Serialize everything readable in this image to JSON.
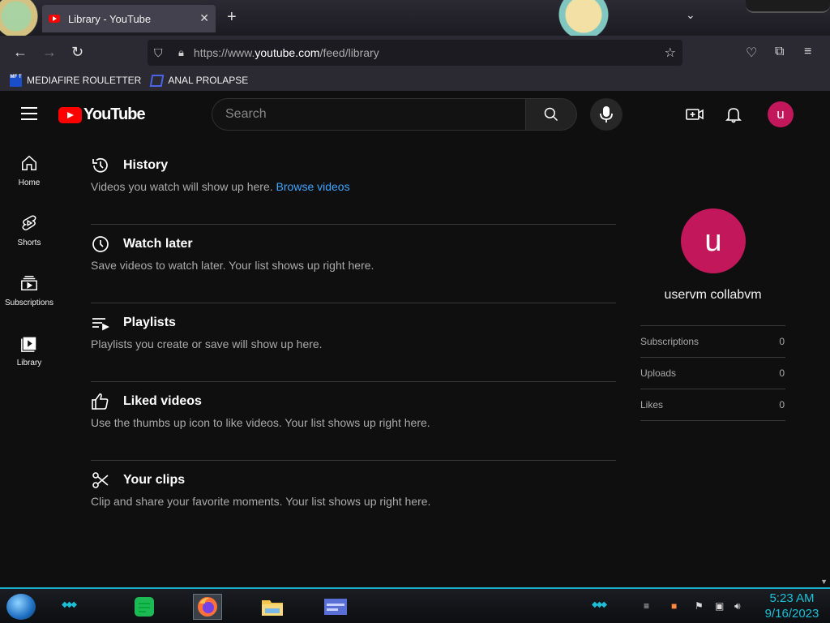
{
  "browser": {
    "tab_title": "Library - YouTube",
    "url_prefix": "https://www.",
    "url_domain": "youtube.com",
    "url_path": "/feed/library",
    "bookmarks": [
      {
        "label": "MEDIAFIRE ROULETTER",
        "icon_text": "MF T"
      },
      {
        "label": "ANAL PROLAPSE"
      }
    ]
  },
  "masthead": {
    "logo_text": "YouTube",
    "search_placeholder": "Search",
    "avatar_letter": "u"
  },
  "guide": [
    {
      "label": "Home",
      "icon": "home-icon"
    },
    {
      "label": "Shorts",
      "icon": "shorts-icon"
    },
    {
      "label": "Subscriptions",
      "icon": "subscriptions-icon"
    },
    {
      "label": "Library",
      "icon": "library-icon"
    }
  ],
  "sections": [
    {
      "title": "History",
      "desc": "Videos you watch will show up here. ",
      "link": "Browse videos",
      "icon": "history-icon"
    },
    {
      "title": "Watch later",
      "desc": "Save videos to watch later. Your list shows up right here.",
      "icon": "clock-icon"
    },
    {
      "title": "Playlists",
      "desc": "Playlists you create or save will show up here.",
      "icon": "playlist-icon"
    },
    {
      "title": "Liked videos",
      "desc": "Use the thumbs up icon to like videos. Your list shows up right here.",
      "icon": "thumbs-up-icon"
    },
    {
      "title": "Your clips",
      "desc": "Clip and share your favorite moments. Your list shows up right here.",
      "icon": "scissors-icon"
    }
  ],
  "profile": {
    "avatar_letter": "u",
    "name": "uservm collabvm",
    "stats": [
      {
        "label": "Subscriptions",
        "value": "0"
      },
      {
        "label": "Uploads",
        "value": "0"
      },
      {
        "label": "Likes",
        "value": "0"
      }
    ]
  },
  "taskbar": {
    "time": "5:23 AM",
    "date": "9/16/2023"
  },
  "colors": {
    "youtube_red": "#ff0000",
    "avatar_bg": "#c2185b",
    "link_blue": "#3ea6ff",
    "taskbar_accent": "#1bc0d8"
  }
}
